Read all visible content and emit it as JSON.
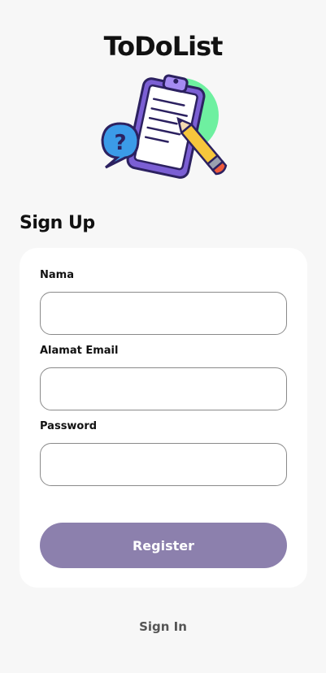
{
  "app": {
    "title": "ToDoList"
  },
  "form": {
    "heading": "Sign Up",
    "fields": [
      {
        "label": "Nama",
        "value": "",
        "placeholder": ""
      },
      {
        "label": "Alamat Email",
        "value": "",
        "placeholder": ""
      },
      {
        "label": "Password",
        "value": "",
        "placeholder": ""
      }
    ],
    "register_label": "Register"
  },
  "footer": {
    "signin_label": "Sign In"
  },
  "colors": {
    "background": "#f7f7f7",
    "card": "#ffffff",
    "button": "#8c80ad",
    "illustration_circle": "#6ef0a0",
    "clipboard": "#8b6fe0",
    "pencil": "#f6c63c",
    "bubble": "#3b9be8"
  },
  "icons": {
    "illustration": "clipboard-checklist-pencil-question-icon"
  }
}
